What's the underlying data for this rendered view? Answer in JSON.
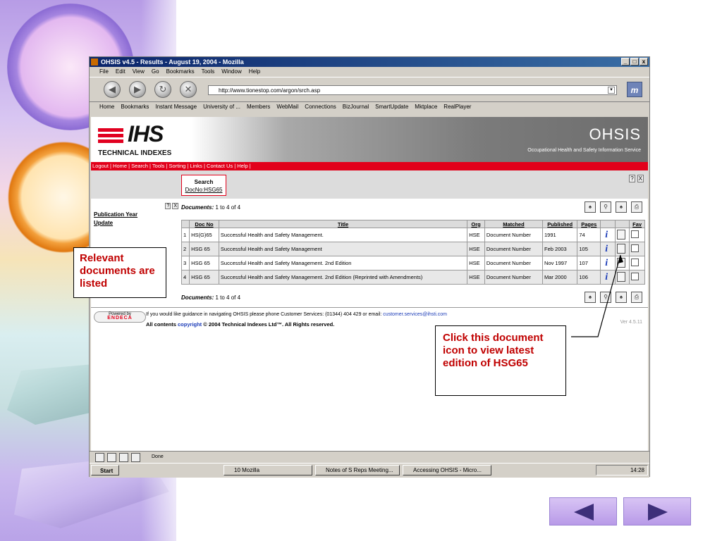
{
  "window": {
    "title": "OHSIS v4.5 - Results - August 19, 2004 - Mozilla",
    "controls": [
      "_",
      "□",
      "x"
    ],
    "menu": [
      "File",
      "Edit",
      "View",
      "Go",
      "Bookmarks",
      "Tools",
      "Window",
      "Help"
    ],
    "url": "http://www.tionestop.com/argon/srch.asp",
    "bookmarks": [
      "Home",
      "Bookmarks",
      "Instant Message",
      "University of ...",
      "Members",
      "WebMail",
      "Connections",
      "BizJournal",
      "SmartUpdate",
      "Mktplace",
      "RealPlayer"
    ]
  },
  "page": {
    "brand": "IHS",
    "brand_sub": "TECHNICAL INDEXES",
    "product": "OHSIS",
    "product_sub": "Occupational Health and Safety Information Service",
    "nav_links": "Logout | Home | Search | Tools | Sorting | Links | Contact Us | Help |",
    "search_label": "Search",
    "search_value": "DocNo:HSG65",
    "help_icons": [
      "?",
      "X"
    ],
    "left_panel": {
      "publication_year": "Publication Year",
      "update": "Update"
    },
    "documents_label": "Documents:",
    "documents_range": "1 to 4 of 4",
    "columns": [
      "",
      "Doc No",
      "Title",
      "Org",
      "Matched",
      "Published",
      "Pages",
      "",
      "",
      "Fav"
    ],
    "rows": [
      {
        "n": "1",
        "doc": "HS(G)65",
        "title": "Successful Health and Safety Management.",
        "org": "HSE",
        "matched": "Document Number",
        "published": "1991",
        "pages": "74"
      },
      {
        "n": "2",
        "doc": "HSG 65",
        "title": "Successful Health and Safety Management",
        "org": "HSE",
        "matched": "Document Number",
        "published": "Feb 2003",
        "pages": "105"
      },
      {
        "n": "3",
        "doc": "HSG 65",
        "title": "Successful Health and Safety Management. 2nd Edition",
        "org": "HSE",
        "matched": "Document Number",
        "published": "Nov 1997",
        "pages": "107"
      },
      {
        "n": "4",
        "doc": "HSG 65",
        "title": "Successful Health and Safety Management. 2nd Edition (Reprinted with Amendments)",
        "org": "HSE",
        "matched": "Document Number",
        "published": "Mar 2000",
        "pages": "106"
      }
    ],
    "powered_by": "Powered by",
    "endeca": "ENDECA",
    "guidance": "If you would like guidance in navigating OHSIS please phone Customer Services: (01344) 404 429 or email:",
    "email": "customer.services@ihsti.com",
    "copyright_pre": "All contents",
    "copyright_link": "copyright",
    "copyright_post": "© 2004 Technical Indexes Ltd™. All Rights reserved.",
    "version": "Ver 4.5.11"
  },
  "status": {
    "text": "Done"
  },
  "taskbar": {
    "start": "Start",
    "tasks": [
      "10 Mozilla",
      "Notes of S Reps Meeting...",
      "Accessing OHSIS - Micro..."
    ],
    "time": "14:28"
  },
  "callouts": {
    "relevant": "Relevant documents are listed",
    "click": "Click  this document icon to view latest edition of HSG65"
  },
  "colors": {
    "accent_red": "#e2001a",
    "callout_text": "#c00000",
    "link_blue": "#1d3db8"
  }
}
